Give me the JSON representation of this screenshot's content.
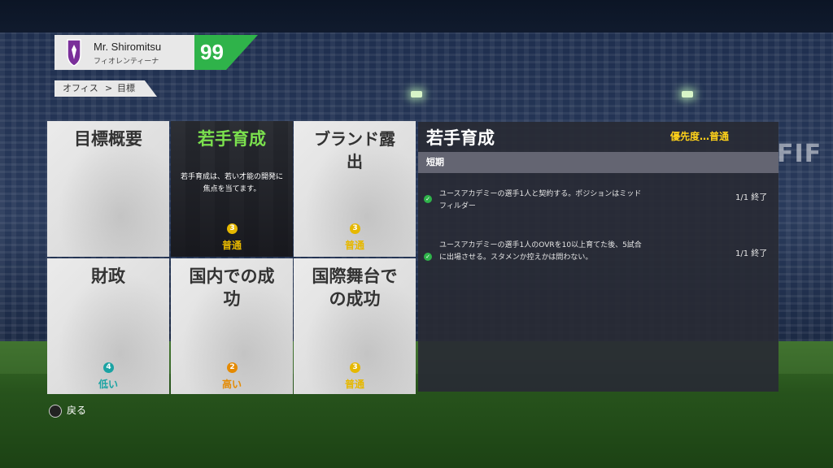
{
  "watermark": "FIF",
  "header": {
    "manager_name": "Mr. Shiromitsu",
    "club_name": "フィオレンティーナ",
    "overall": "99"
  },
  "breadcrumb": {
    "parent": "オフィス",
    "separator": ">",
    "current": "目標"
  },
  "tiles": [
    {
      "title": "目標概要",
      "badge": "",
      "priority": ""
    },
    {
      "title": "若手育成",
      "badge": "3",
      "priority": "普通",
      "description": "若手育成は、若い才能の開発に焦点を当てます。",
      "selected": true
    },
    {
      "title": "ブランド露出",
      "badge": "3",
      "priority": "普通"
    },
    {
      "title": "財政",
      "badge": "4",
      "priority": "低い"
    },
    {
      "title": "国内での成功",
      "badge": "2",
      "priority": "高い"
    },
    {
      "title": "国際舞台での成功",
      "badge": "3",
      "priority": "普通"
    }
  ],
  "colors": {
    "accent_green": "#2fb34a",
    "priority_normal": "#e6b800",
    "priority_low": "#1aa3a3",
    "priority_high": "#e58a00",
    "selected_title": "#7be04e",
    "panel_priority": "#ffd21a"
  },
  "panel": {
    "title": "若手育成",
    "priority_label": "優先度…普通",
    "section": "短期",
    "tasks": [
      {
        "text": "ユースアカデミーの選手1人と契約する。ポジションはミッドフィルダー",
        "status": "1/1 終了",
        "icon": "check-icon"
      },
      {
        "text": "ユースアカデミーの選手1人のOVRを10以上育てた後、5試合に出場させる。スタメンか控えかは問わない。",
        "status": "1/1 終了",
        "icon": "check-icon"
      }
    ]
  },
  "footer": {
    "back_label": "戻る",
    "back_icon": "cross-button-icon"
  }
}
